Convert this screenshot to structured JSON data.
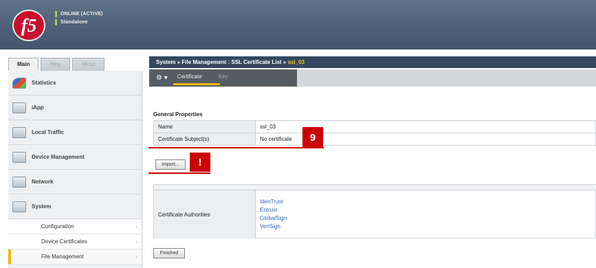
{
  "header": {
    "logo_text": "f5",
    "status_line1": "ONLINE (ACTIVE)",
    "status_line2": "Standalone"
  },
  "nav": {
    "tabs": [
      {
        "label": "Main"
      },
      {
        "label": "Help"
      },
      {
        "label": "About"
      }
    ],
    "items": [
      {
        "label": "Statistics"
      },
      {
        "label": "iApp"
      },
      {
        "label": "Local Traffic"
      },
      {
        "label": "Device Management"
      },
      {
        "label": "Network"
      },
      {
        "label": "System"
      }
    ],
    "sub_items": [
      {
        "label": "Configuration"
      },
      {
        "label": "Device Certificates"
      },
      {
        "label": "File Management"
      }
    ]
  },
  "breadcrumb": {
    "path": "System » File Management : SSL Certificate List » ",
    "current": "ssl_03"
  },
  "subtabs": [
    {
      "label": "Certificate"
    },
    {
      "label": "Key"
    }
  ],
  "general": {
    "title": "General Properties",
    "rows": [
      {
        "label": "Name",
        "value": "ssl_03"
      },
      {
        "label": "Certificate Subject(s)",
        "value": "No certificate"
      }
    ]
  },
  "callouts": {
    "step": "9",
    "alert": "!"
  },
  "import_button": "Import...",
  "authorities": {
    "label": "Certificate Authorities",
    "links": [
      "IdenTrust",
      "Entrust",
      "GlobalSign",
      "VeriSign"
    ]
  },
  "finished_button": "Finished"
}
